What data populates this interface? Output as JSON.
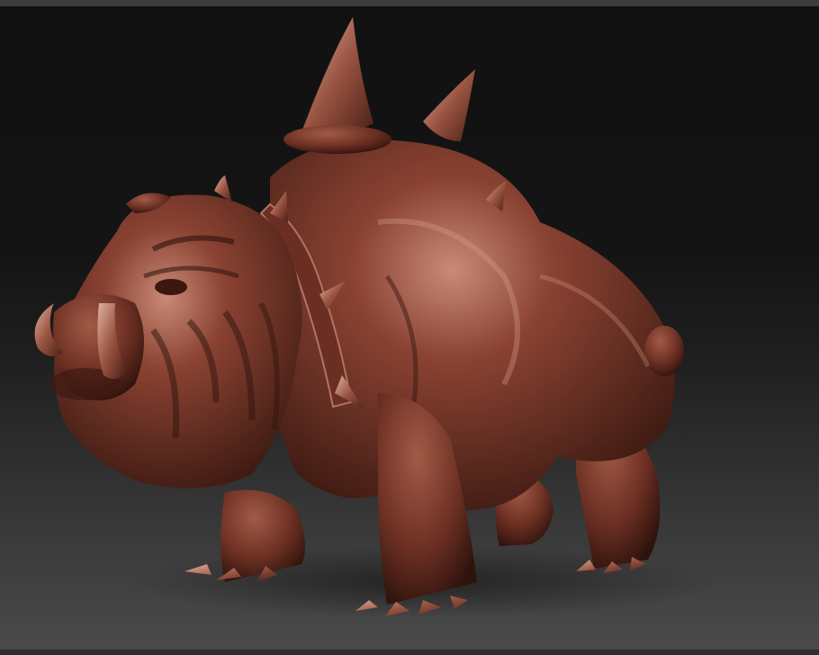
{
  "canvas": {
    "background_top": "#111111",
    "background_bottom": "#4a4a4a"
  },
  "model": {
    "icon": "bulldog-sculpt-icon",
    "material_base": "#8a4232",
    "material_shadow": "#3d1a12",
    "material_highlight": "#d7a08c"
  }
}
